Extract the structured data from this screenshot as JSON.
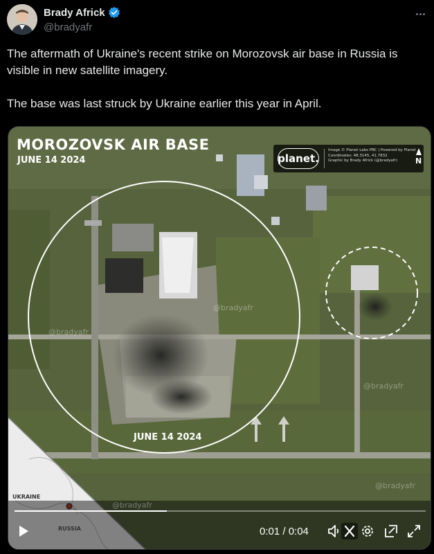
{
  "author": {
    "display_name": "Brady Africk",
    "handle": "@bradyafr"
  },
  "tweet": {
    "paragraphs": [
      "The aftermath of Ukraine's recent strike on Morozovsk air base in Russia is visible in new satellite imagery.",
      "The base was last struck by Ukraine earlier this year in April."
    ]
  },
  "image": {
    "title": "MOROZOVSK AIR BASE",
    "date": "JUNE 14 2024",
    "circle_date": "JUNE 14 2024",
    "watermark": "@bradyafr",
    "planet": {
      "logo": "planet.",
      "credit": "Image © Planet Labs PBC | Powered by Planet",
      "coordinates": "Coordinates: 48.3145, 41.7832",
      "graphic": "Graphic by Brady Africk (@bradyafr)",
      "north": "N"
    },
    "inset_map": {
      "country_a": "UKRAINE",
      "country_b": "RUSSIA"
    }
  },
  "video": {
    "time": "0:01 / 0:04",
    "progress": 0.37
  },
  "icons": {
    "verified": "verified-badge-icon",
    "more": "more-icon",
    "play": "play-icon",
    "volume": "volume-icon",
    "x": "x-logo-icon",
    "settings": "settings-icon",
    "pip": "picture-in-picture-icon",
    "fullscreen": "fullscreen-icon"
  },
  "colors": {
    "accent_verified": "#1d9bf0",
    "text_primary": "#e7e9ea",
    "text_secondary": "#71767b"
  }
}
